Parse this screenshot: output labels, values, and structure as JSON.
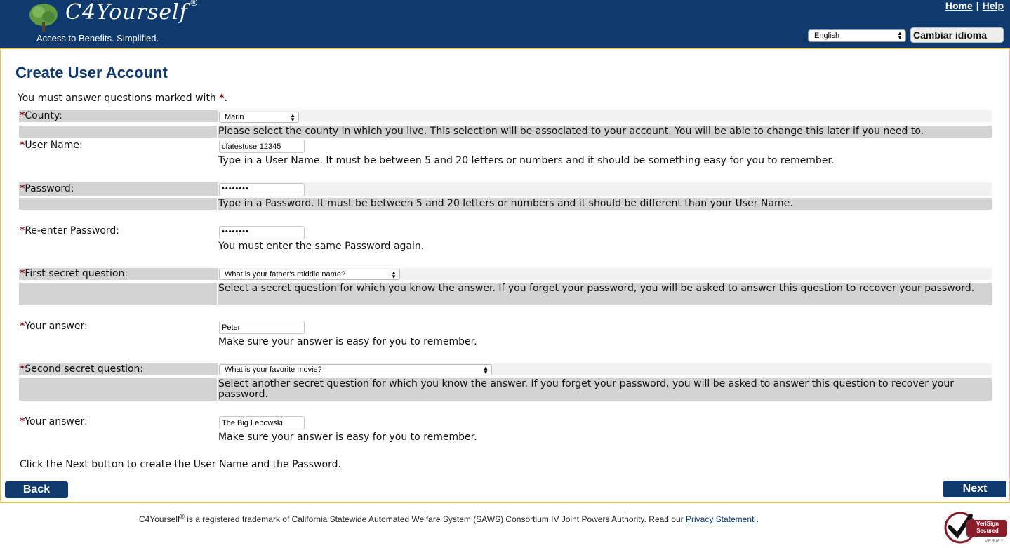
{
  "header": {
    "brand": "C4Yourself",
    "brand_mark": "®",
    "tagline": "Access to Benefits.  Simplified.",
    "links": {
      "home": "Home",
      "separator": "|",
      "help": "Help"
    },
    "language_select": {
      "value": "English"
    },
    "language_button": "Cambiar idioma"
  },
  "page": {
    "title": "Create User Account",
    "intro_prefix": "You must answer questions marked with ",
    "intro_star": "*",
    "intro_suffix": "."
  },
  "fields": {
    "county": {
      "label": "County:",
      "value": "Marin",
      "help": "Please select the county in which you live. This selection will be associated to your account. You will be able to change this later if you need to."
    },
    "username": {
      "label": "User Name:",
      "value": "cfatestuser12345",
      "help": "Type in a User Name. It must be between 5 and 20 letters or numbers and it should be something easy for you to remember."
    },
    "password": {
      "label": "Password:",
      "value": "••••••••",
      "help": "Type in a Password. It must be between 5 and 20 letters or numbers and it should be different than your User Name."
    },
    "password2": {
      "label": "Re-enter Password:",
      "value": "••••••••",
      "help": "You must enter the same Password again."
    },
    "question1": {
      "label": "First secret question:",
      "value": "What is your father's middle name?",
      "help": "Select a secret question for which you know the answer. If you forget your password, you will be asked to answer this question to recover your password."
    },
    "answer1": {
      "label": "Your answer:",
      "value": "Peter",
      "help": "Make sure your answer is easy for you to remember."
    },
    "question2": {
      "label": "Second secret question:",
      "value": "What is your favorite movie?",
      "help": "Select another secret question for which you know the answer. If you forget your password, you will be asked to answer this question to recover your password."
    },
    "answer2": {
      "label": "Your answer:",
      "value": "The Big Lebowski",
      "help": "Make sure your answer is easy for you to remember."
    }
  },
  "required_mark": "*",
  "instruction": "Click the Next button to create the User Name and the Password.",
  "buttons": {
    "back": "Back",
    "next": "Next"
  },
  "footer": {
    "brand": "C4Yourself",
    "mark": "®",
    "text": " is a registered trademark of California Statewide Automated Welfare System (SAWS) Consortium IV Joint Powers Authority. Read our ",
    "privacy_link": "Privacy Statement ",
    "end": "."
  },
  "badge": {
    "line1": "VeriSign",
    "line2": "Secured",
    "line3": "VERIFY"
  },
  "colors": {
    "header_bg": "#0f3a6e",
    "frame_border": "#e6c25a",
    "row_shade": "#d3d3d3",
    "required": "#7a1010"
  }
}
